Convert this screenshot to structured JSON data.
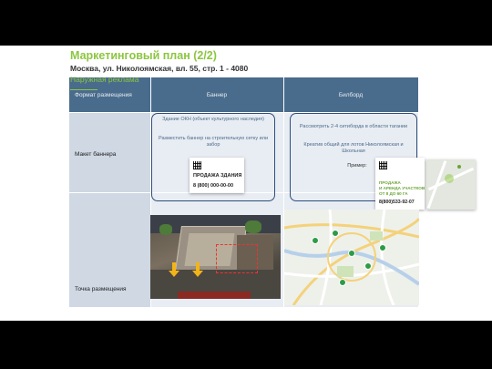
{
  "slide": {
    "title": "Маркетинговый план (2/2)",
    "subtitle": "Москва, ул. Николоямская, вл. 55, стр. 1 - 4080",
    "section": "Наружная реклама"
  },
  "table": {
    "headers": [
      "Формат размещения",
      "Баннер",
      "Билборд"
    ],
    "rows": [
      "Макет баннера",
      "Точка размещения"
    ]
  },
  "banner": {
    "note1": "Здание ОКН (объект культурного наследия)",
    "note2": "Разместить баннер на строительную сетку или забор",
    "sign_line1": "ПРОДАЖА ЗДАНИЯ",
    "sign_line2": "8 (800) 000-00-00"
  },
  "billboard": {
    "note1": "Рассмотреть 2-4 ситиборда в области тагании",
    "note2": "Креатив общий для лотов Николоямская и Школьная",
    "example": "Пример:",
    "sign_line1": "ПРОДАЖА",
    "sign_line2": "И АРЕНДА УЧАСТКОВ",
    "sign_line3": "ОТ 8 ДО 60 ГА",
    "sign_phone": "8(800)533-92-07"
  },
  "colors": {
    "accent": "#8cc63f",
    "header_bg": "#4a6c8c",
    "frame": "#2f4e7d"
  },
  "icons": [
    "arrow-down-icon",
    "map-pin-icon",
    "qr-code-icon"
  ]
}
